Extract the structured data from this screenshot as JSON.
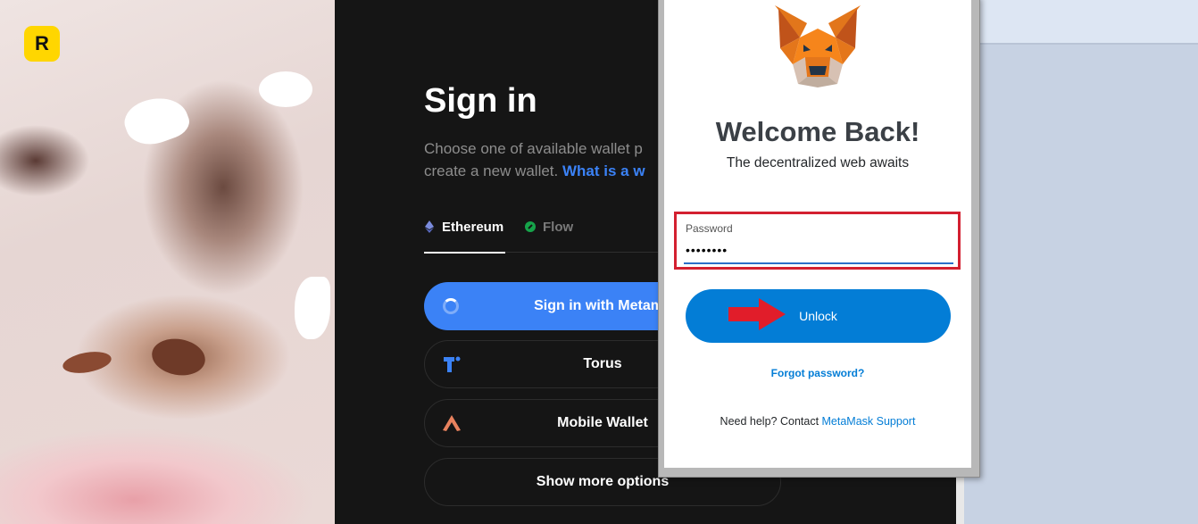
{
  "art": {
    "logo_letter": "R"
  },
  "signin": {
    "title": "Sign in",
    "subtitle_line1": "Choose one of available wallet p",
    "subtitle_line2_text": "create a new wallet. ",
    "subtitle_link": "What is a w",
    "tabs": [
      {
        "label": "Ethereum",
        "icon": "ethereum-icon",
        "active": true
      },
      {
        "label": "Flow",
        "icon": "flow-icon",
        "active": false
      }
    ],
    "options": [
      {
        "label": "Sign in with Metama",
        "icon": "spinner-icon"
      },
      {
        "label": "Torus",
        "icon": "torus-icon"
      },
      {
        "label": "Mobile Wallet",
        "icon": "mobile-wallet-icon"
      },
      {
        "label": "Show more options",
        "icon": ""
      }
    ]
  },
  "metamask": {
    "title": "Welcome Back!",
    "subtitle": "The decentralized web awaits",
    "password_label": "Password",
    "password_value": "••••••••",
    "unlock_label": "Unlock",
    "forgot_label": "Forgot password?",
    "help_text": "Need help? Contact ",
    "help_link": "MetaMask Support"
  },
  "colors": {
    "primary_blue": "#3b82f6",
    "metamask_blue": "#037dd6",
    "highlight_red": "#d32030",
    "logo_yellow": "#ffd600"
  }
}
